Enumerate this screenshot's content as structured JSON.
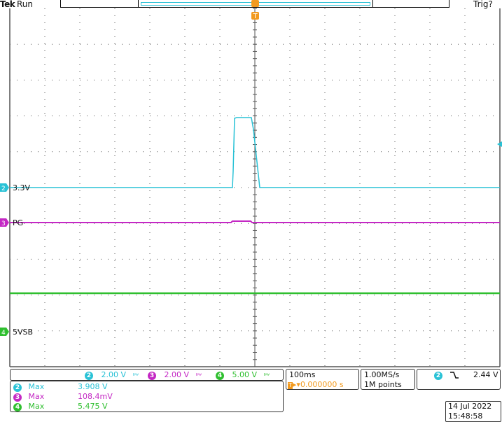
{
  "header": {
    "brand": "Tek",
    "run_state": "Run",
    "trigger_status": "Trig?"
  },
  "colors": {
    "ch2": "#29c2d6",
    "ch3": "#c428c4",
    "ch4": "#2fbf2f",
    "trigger": "#f29a1f",
    "grid": "#555555"
  },
  "channels": {
    "ch2": {
      "badge": "2",
      "marker_label": "3.3V",
      "scale": "2.00 V"
    },
    "ch3": {
      "badge": "3",
      "marker_label": "PG",
      "scale": "2.00 V"
    },
    "ch4": {
      "badge": "4",
      "marker_label": "5VSB",
      "scale": "5.00 V"
    }
  },
  "bw_icon": "bandwidth-limit-icon",
  "timebase": {
    "time_per_div": "100ms",
    "trigger_position": "0.000000 s",
    "sample_rate": "1.00MS/s",
    "record_length": "1M points"
  },
  "trigger": {
    "source": "2",
    "slope_icon": "falling-edge-icon",
    "level": "2.44 V"
  },
  "measurements": [
    {
      "channel": "2",
      "type": "Max",
      "value": "3.908 V",
      "color": "#29c2d6"
    },
    {
      "channel": "3",
      "type": "Max",
      "value": "108.4mV",
      "color": "#c428c4"
    },
    {
      "channel": "4",
      "type": "Max",
      "value": "5.475 V",
      "color": "#2fbf2f"
    }
  ],
  "datetime": {
    "date": "14 Jul  2022",
    "time": "15:48:58"
  }
}
